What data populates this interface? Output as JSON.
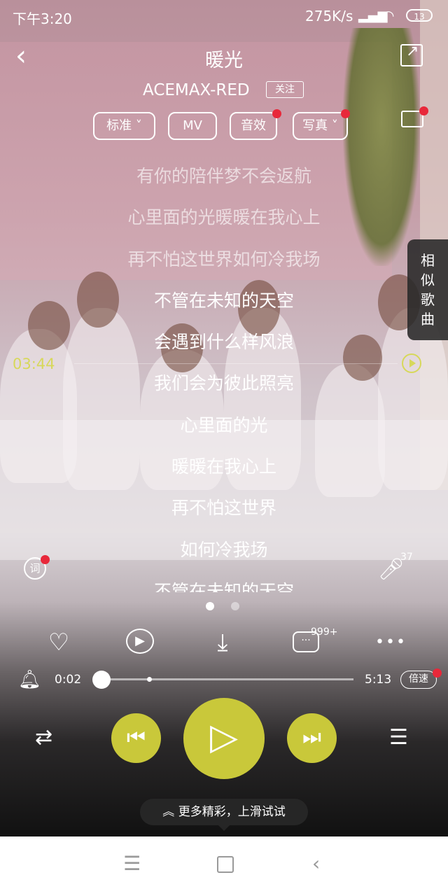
{
  "status_bar": {
    "time": "下午3:20",
    "speed": "275K/s",
    "signal": "HD",
    "battery": "13"
  },
  "header": {
    "title": "暖光",
    "artist": "ACEMAX-RED",
    "follow": "关注"
  },
  "pills": {
    "quality": "标准",
    "mv": "MV",
    "effect": "音效",
    "photo": "写真"
  },
  "lyrics": [
    "有你的陪伴梦不会返航",
    "心里面的光暖暖在我心上",
    "再不怕这世界如何冷我场",
    "不管在未知的天空",
    "会遇到什么样风浪",
    "我们会为彼此照亮",
    "心里面的光",
    "暖暖在我心上",
    "再不怕这世界",
    "如何冷我场",
    "不管在未知的天空"
  ],
  "lyric_position": {
    "time": "03:44"
  },
  "similar_songs": [
    "相",
    "似",
    "歌",
    "曲"
  ],
  "lyric_button": "词",
  "mic_count": "37",
  "comment_count": "999+",
  "player": {
    "current": "0:02",
    "duration": "5:13",
    "speed": "倍速",
    "progress": 0.006
  },
  "tip": "更多精彩，上滑试试",
  "colors": {
    "accent": "#c9c83a",
    "badge": "#e8283a",
    "lyric_active": "#ffffff"
  }
}
